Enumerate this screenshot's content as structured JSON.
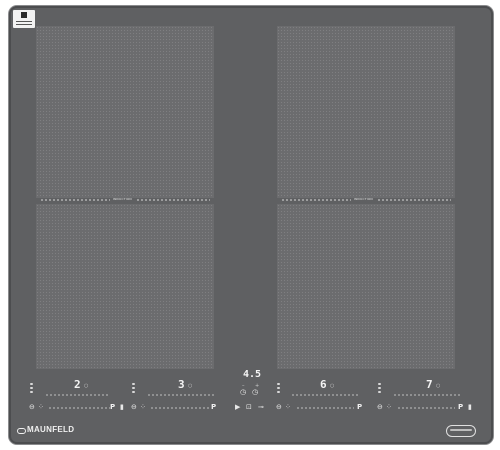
{
  "brand": {
    "name": "MAUNFELD"
  },
  "zones": {
    "front_left_label": "INDUCTION",
    "front_right_label": "INDUCTION"
  },
  "controls": {
    "zone1_level": "2",
    "zone2_level": "3",
    "zone3_level": "6",
    "zone4_level": "7",
    "timer": "4.5",
    "p_label": "P"
  }
}
